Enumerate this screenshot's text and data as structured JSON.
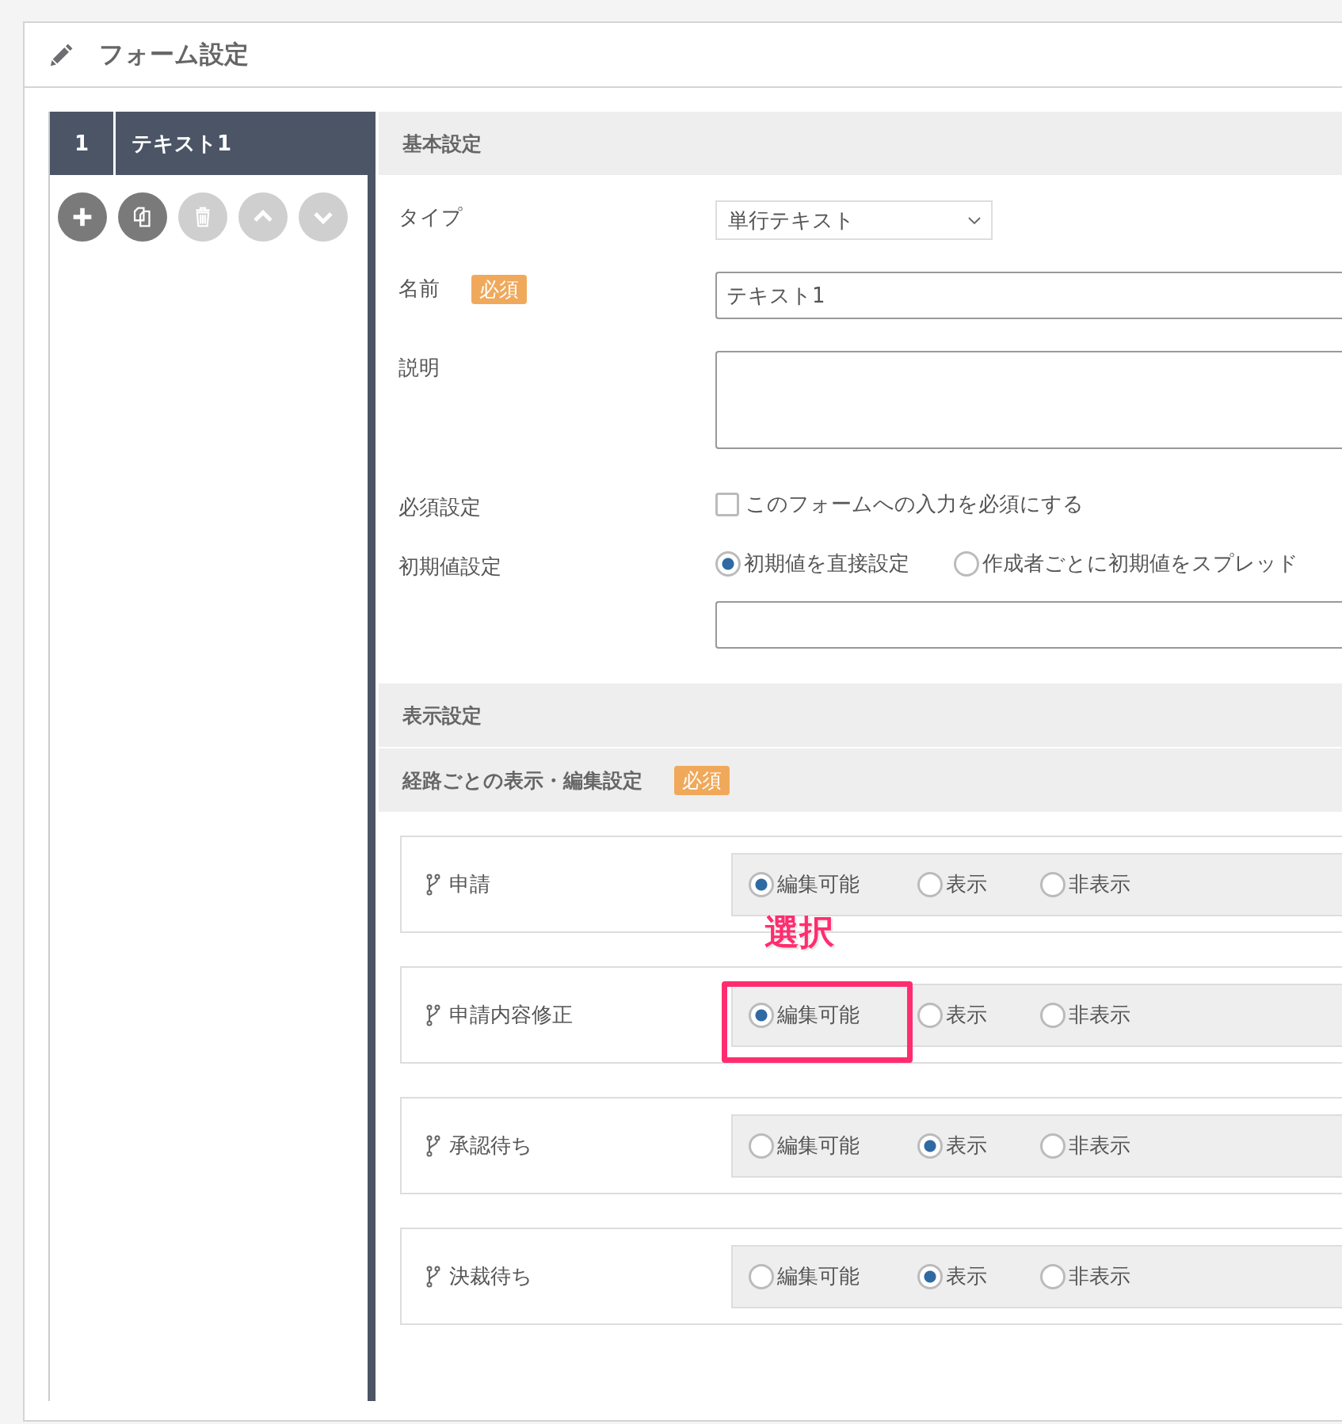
{
  "title": "フォーム設定",
  "sidebar": {
    "items": [
      {
        "number": "1",
        "label": "テキスト1",
        "selected": true
      }
    ],
    "actions": [
      {
        "kind": "add",
        "disabled": false
      },
      {
        "kind": "copy",
        "disabled": false
      },
      {
        "kind": "delete",
        "disabled": true
      },
      {
        "kind": "up",
        "disabled": true
      },
      {
        "kind": "down",
        "disabled": true
      }
    ]
  },
  "basic": {
    "heading": "基本設定",
    "fields": [
      {
        "kind": "select",
        "label": "タイプ",
        "value": "単行テキスト"
      },
      {
        "kind": "text",
        "label": "名前",
        "badge": "必須",
        "value": "テキスト1"
      },
      {
        "kind": "textarea",
        "label": "説明"
      },
      {
        "kind": "checkbox",
        "label": "必須設定",
        "text": "このフォームへの入力を必須にする",
        "checked": false
      },
      {
        "kind": "radio",
        "label": "初期値設定",
        "options": [
          {
            "label": "初期値を直接設定",
            "selected": true
          },
          {
            "label": "作成者ごとに初期値をスプレッド",
            "selected": false
          }
        ]
      }
    ]
  },
  "display": {
    "heading": "表示設定",
    "subheading": "経路ごとの表示・編集設定",
    "badge": "必須",
    "routes": [
      {
        "label": "申請",
        "options": [
          {
            "label": "編集可能",
            "selected": true
          },
          {
            "label": "表示",
            "selected": false
          },
          {
            "label": "非表示",
            "selected": false
          }
        ]
      },
      {
        "label": "申請内容修正",
        "callout": "選択",
        "options": [
          {
            "label": "編集可能",
            "selected": true,
            "highlighted": true
          },
          {
            "label": "表示",
            "selected": false
          },
          {
            "label": "非表示",
            "selected": false
          }
        ]
      },
      {
        "label": "承認待ち",
        "options": [
          {
            "label": "編集可能",
            "selected": false
          },
          {
            "label": "表示",
            "selected": true
          },
          {
            "label": "非表示",
            "selected": false
          }
        ]
      },
      {
        "label": "決裁待ち",
        "options": [
          {
            "label": "編集可能",
            "selected": false
          },
          {
            "label": "表示",
            "selected": true
          },
          {
            "label": "非表示",
            "selected": false
          }
        ]
      }
    ]
  }
}
